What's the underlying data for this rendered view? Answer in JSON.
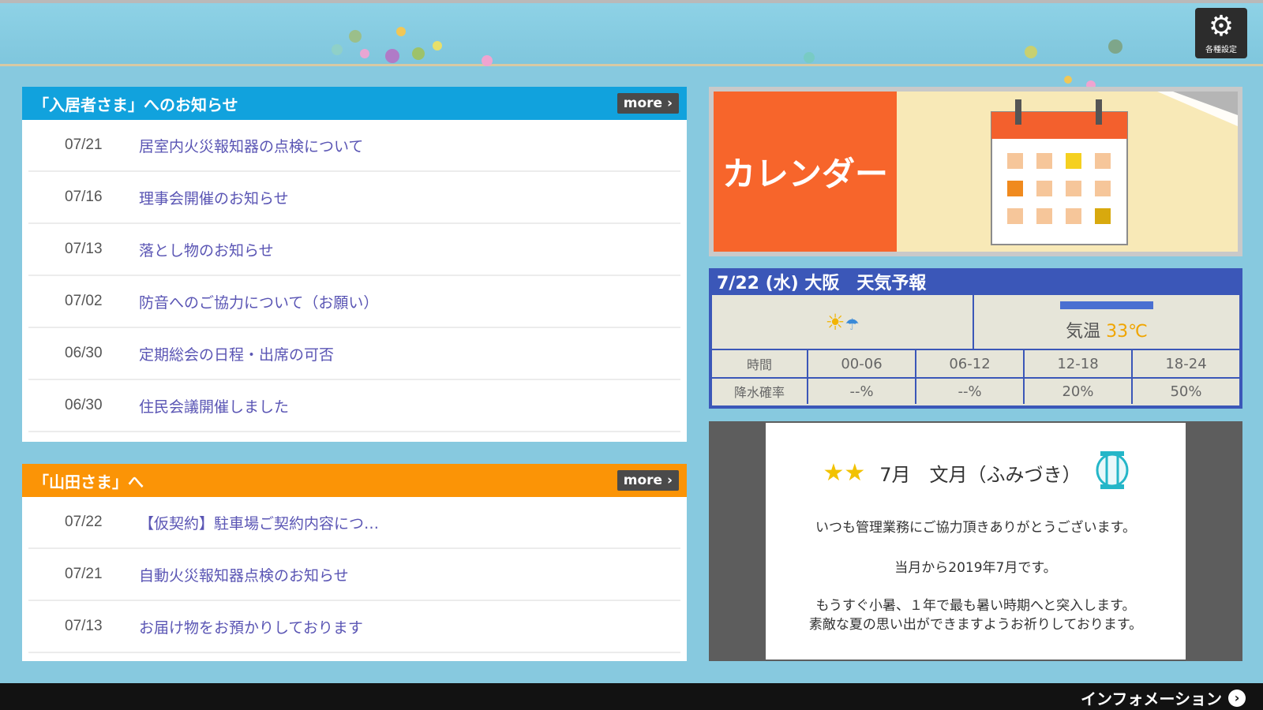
{
  "header": {
    "settings_label": "各種設定"
  },
  "notices": {
    "title": "「入居者さま」へのお知らせ",
    "more_label": "more ›",
    "items": [
      {
        "date": "07/21",
        "title": "居室内火災報知器の点検について"
      },
      {
        "date": "07/16",
        "title": "理事会開催のお知らせ"
      },
      {
        "date": "07/13",
        "title": "落とし物のお知らせ"
      },
      {
        "date": "07/02",
        "title": "防音へのご協力について（お願い）"
      },
      {
        "date": "06/30",
        "title": "定期総会の日程・出席の可否"
      },
      {
        "date": "06/30",
        "title": "住民会議開催しました"
      }
    ]
  },
  "personal": {
    "title": "「山田さま」へ",
    "more_label": "more ›",
    "items": [
      {
        "date": "07/22",
        "title": "【仮契約】駐車場ご契約内容につ…"
      },
      {
        "date": "07/21",
        "title": "自動火災報知器点検のお知らせ"
      },
      {
        "date": "07/13",
        "title": "お届け物をお預かりしております"
      }
    ]
  },
  "calendar": {
    "label": "カレンダー"
  },
  "weather": {
    "title": "7/22 (水) 大阪　天気予報",
    "temp_label": "気温",
    "temp_value": "33℃",
    "time_header": "時間",
    "precip_header": "降水確率",
    "periods": [
      "00-06",
      "06-12",
      "12-18",
      "18-24"
    ],
    "precip": [
      "--%",
      "--%",
      "20%",
      "50%"
    ]
  },
  "message": {
    "heading": "7月　文月（ふみづき）",
    "line1": "いつも管理業務にご協力頂きありがとうございます。",
    "line2": "当月から2019年7月です。",
    "line3": "もうすぐ小暑、１年で最も暑い時期へと突入します。",
    "line4": "素敵な夏の思い出ができますようお祈りしております。"
  },
  "footer": {
    "info_label": "インフォメーション"
  },
  "colors": {
    "notice_header": "#11a2dd",
    "personal_header": "#fb9406",
    "calendar_orange": "#f7652b",
    "weather_blue": "#3b57b8"
  }
}
